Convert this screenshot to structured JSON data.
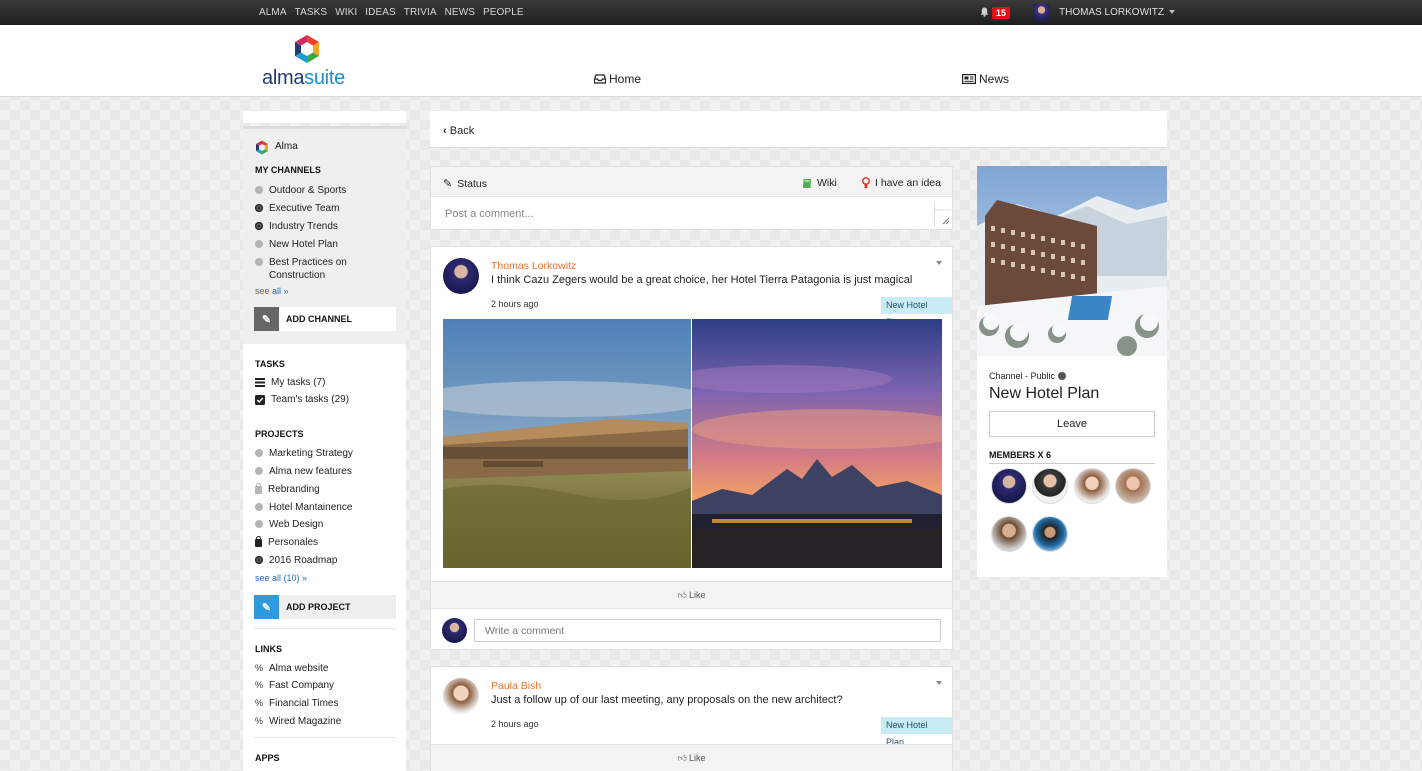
{
  "topbar": {
    "nav": [
      "ALMA",
      "TASKS",
      "WIKI",
      "IDEAS",
      "TRIVIA",
      "NEWS",
      "PEOPLE"
    ],
    "notifications": "15",
    "user": "THOMAS LORKOWITZ"
  },
  "header": {
    "logo_alma": "alma",
    "logo_suite": "suite",
    "home": "Home",
    "news": "News"
  },
  "sidebar": {
    "alma": "Alma",
    "my_channels_title": "MY CHANNELS",
    "channels": [
      {
        "label": "Outdoor & Sports",
        "icon": "grey"
      },
      {
        "label": "Executive Team",
        "icon": "globe"
      },
      {
        "label": "Industry Trends",
        "icon": "globe"
      },
      {
        "label": "New Hotel Plan",
        "icon": "grey"
      },
      {
        "label": "Best Practices on Construction",
        "icon": "grey"
      }
    ],
    "channels_see_all": "see all »",
    "add_channel": "ADD CHANNEL",
    "tasks_title": "TASKS",
    "tasks": [
      "My tasks (7)",
      "Team's tasks (29)"
    ],
    "projects_title": "PROJECTS",
    "projects": [
      {
        "label": "Marketing Strategy",
        "icon": "grey"
      },
      {
        "label": "Alma new features",
        "icon": "grey"
      },
      {
        "label": "Rebranding",
        "icon": "lock"
      },
      {
        "label": "Hotel Mantainence",
        "icon": "grey"
      },
      {
        "label": "Web Design",
        "icon": "grey"
      },
      {
        "label": "Personales",
        "icon": "lock-dark"
      },
      {
        "label": "2016 Roadmap",
        "icon": "globe"
      }
    ],
    "projects_see_all": "see all (10) »",
    "add_project": "ADD PROJECT",
    "links_title": "LINKS",
    "links": [
      "Alma website",
      "Fast Company",
      "Financial Times",
      "Wired Magazine"
    ],
    "apps_title": "APPS"
  },
  "back": "Back",
  "composer": {
    "status": "Status",
    "wiki": "Wiki",
    "idea": "I have an idea",
    "placeholder": "Post a comment..."
  },
  "posts": [
    {
      "author": "Thomas Lorkowitz",
      "text": "I think Cazu Zegers would be a great choice, her Hotel Tierra Patagonia is just magical",
      "time": "2 hours ago",
      "channel": "New Hotel Plan",
      "like": "Like",
      "comment_placeholder": "Write a comment"
    },
    {
      "author": "Paula Bish",
      "text": "Just a follow up of our last meeting, any proposals on the new architect?",
      "time": "2 hours ago",
      "channel": "New Hotel Plan",
      "like": "Like"
    }
  ],
  "channel_card": {
    "subtitle": "Channel - Public",
    "name": "New Hotel Plan",
    "leave": "Leave",
    "members_title": "MEMBERS X 6"
  },
  "colors": {
    "author": "#e8742a",
    "tag_bg": "#c8ecf5",
    "badge": "#e3101a",
    "link": "#2a6db5"
  }
}
